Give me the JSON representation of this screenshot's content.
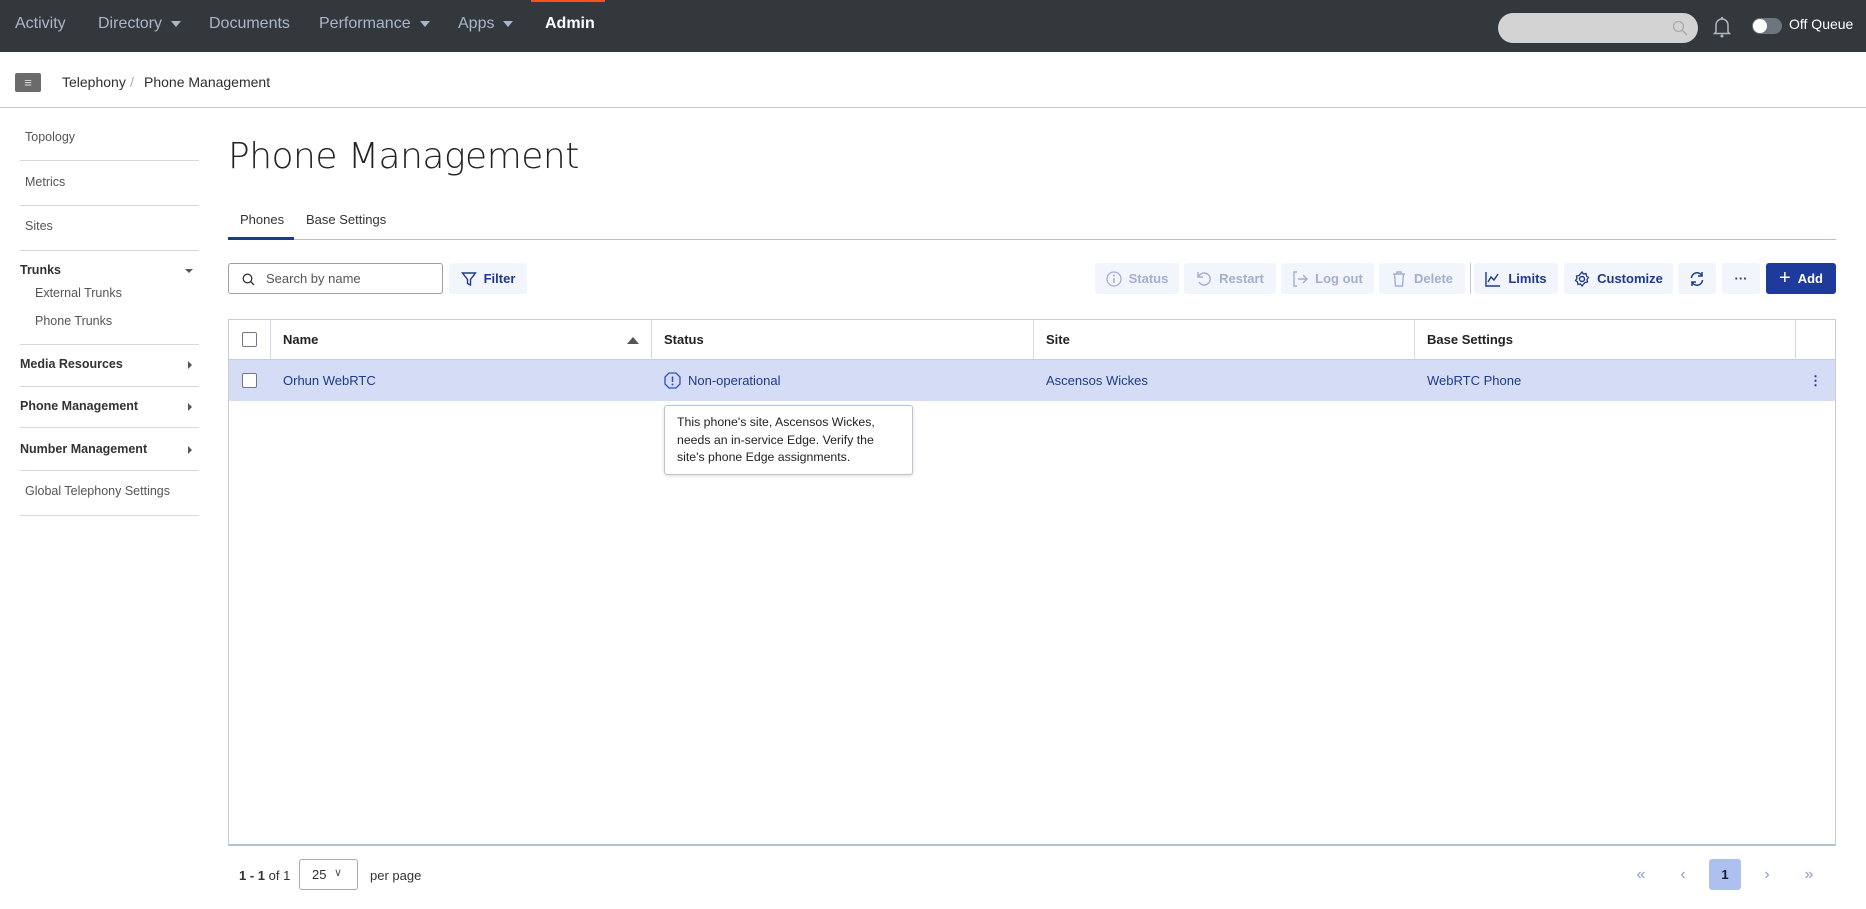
{
  "topnav": {
    "items": [
      {
        "label": "Activity"
      },
      {
        "label": "Directory"
      },
      {
        "label": "Documents"
      },
      {
        "label": "Performance"
      },
      {
        "label": "Apps"
      },
      {
        "label": "Admin"
      }
    ],
    "queue_label": "Off Queue",
    "accent": "#ff4f1f"
  },
  "breadcrumb": [
    "Telephony",
    "Phone Management"
  ],
  "sidebar": {
    "topology": "Topology",
    "metrics": "Metrics",
    "sites": "Sites",
    "trunks": "Trunks",
    "external_trunks": "External Trunks",
    "phone_trunks": "Phone Trunks",
    "media": "Media Resources",
    "phone_mgmt": "Phone Management",
    "number_mgmt": "Number Management",
    "global": "Global Telephony Settings"
  },
  "page": {
    "title": "Phone Management",
    "tabs": [
      "Phones",
      "Base Settings"
    ]
  },
  "toolbar": {
    "search_placeholder": "Search by name",
    "filter": "Filter",
    "status": "Status",
    "restart": "Restart",
    "logout": "Log out",
    "delete": "Delete",
    "limits": "Limits",
    "customize": "Customize",
    "add": "Add"
  },
  "table": {
    "headers": [
      "Name",
      "Status",
      "Site",
      "Base Settings"
    ],
    "rows": [
      {
        "name": "Orhun WebRTC",
        "status": "Non-operational",
        "site": "Ascensos Wickes",
        "base": "WebRTC Phone"
      }
    ]
  },
  "tooltip": "This phone's site, Ascensos Wickes, needs an in-service Edge. Verify the site's phone Edge assignments.",
  "pagination": {
    "range": "1 - 1",
    "of": "of 1",
    "per_page_value": "25",
    "per_page_label": "per page",
    "current": "1"
  }
}
